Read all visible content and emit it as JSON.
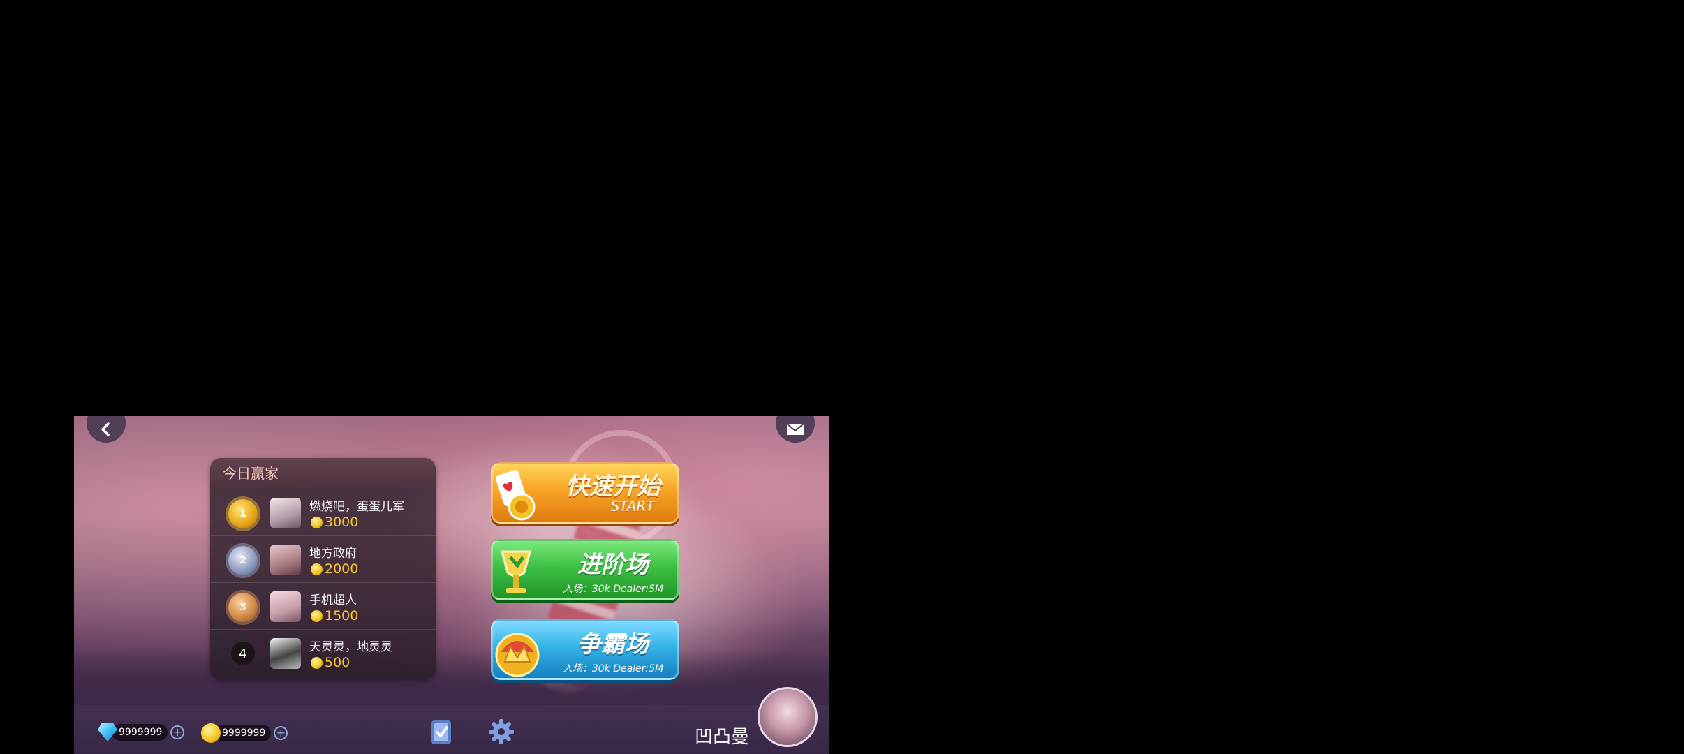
{
  "leaderboard": {
    "title": "今日赢家",
    "entries": [
      {
        "rank": "1",
        "medal": "gold-medal",
        "name": "燃烧吧，蛋蛋儿军",
        "score": "3000"
      },
      {
        "rank": "2",
        "medal": "silver-medal",
        "name": "地方政府",
        "score": "2000"
      },
      {
        "rank": "3",
        "medal": "bronze-medal",
        "name": "手机超人",
        "score": "1500"
      },
      {
        "rank": "4",
        "medal": "none",
        "name": "天灵灵，地灵灵",
        "score": "500"
      }
    ]
  },
  "modes": {
    "quick": {
      "title": "快速开始",
      "subtitle": "START",
      "icon": "cards-chips-icon"
    },
    "advanced": {
      "title": "进阶场",
      "entry": "入场：30k    Dealer:5M",
      "icon": "trophy-icon"
    },
    "champion": {
      "title": "争霸场",
      "entry": "入场：30k    Dealer:5M",
      "icon": "crown-icon"
    }
  },
  "bottom": {
    "diamonds": "9999999",
    "coins": "9999999",
    "username": "凹凸曼"
  },
  "colors": {
    "quick": "#f8a526",
    "advanced": "#3cc043",
    "champion": "#35b3e8",
    "score": "#f7c531"
  }
}
